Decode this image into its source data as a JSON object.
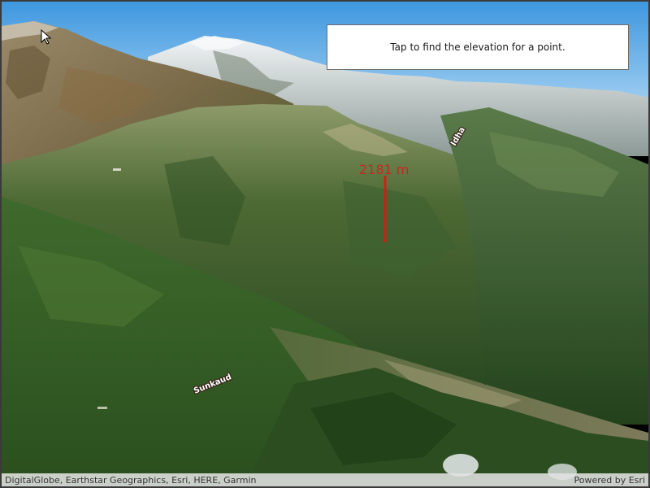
{
  "instruction": {
    "text": "Tap to find the elevation for a point."
  },
  "elevation_marker": {
    "label": "2181 m",
    "color": "#d61c1c"
  },
  "place_labels": {
    "label_1": "Sunkaud",
    "label_2": "Idha"
  },
  "attribution": {
    "sources": "DigitalGlobe, Earthstar Geographics, Esri, HERE, Garmin",
    "powered_by": "Powered by Esri"
  },
  "colors": {
    "sky": "#4fa3e3",
    "snow": "#e8eef2",
    "forest": "#2f5a24",
    "ridge": "#6b7a3a"
  }
}
